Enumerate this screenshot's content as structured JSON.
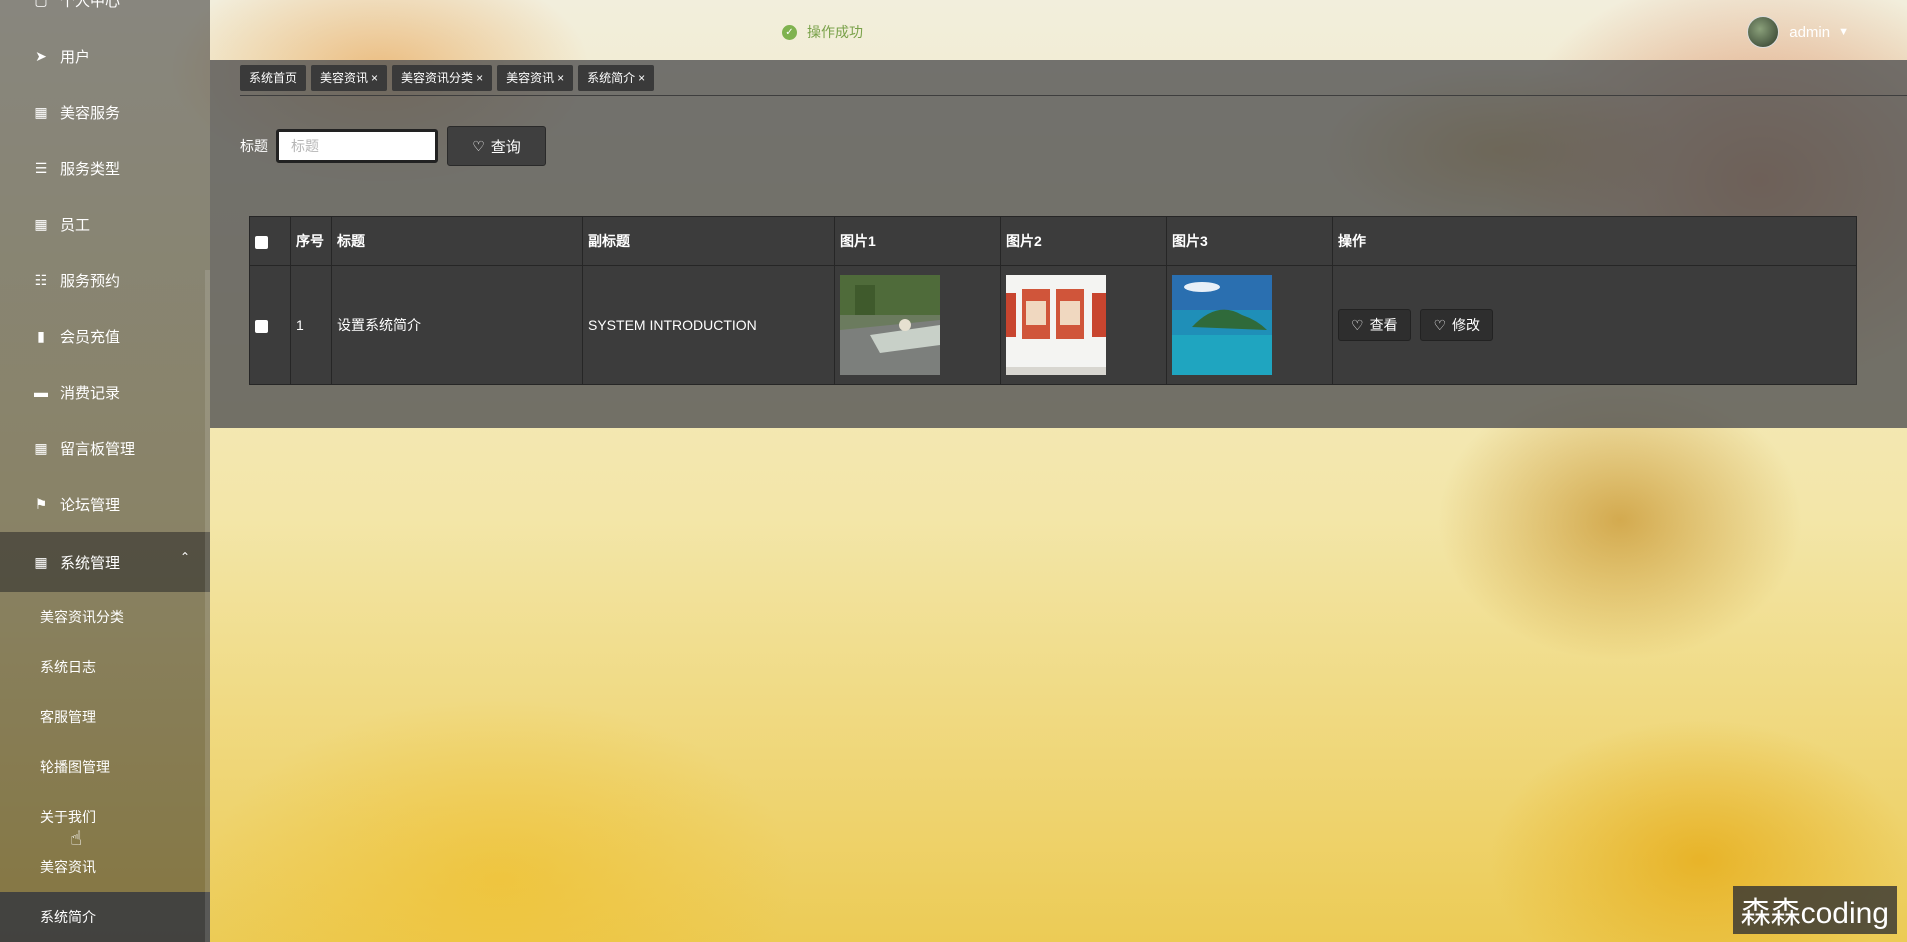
{
  "sidebar": {
    "top_partial": "个人中心",
    "items": [
      {
        "label": "用户",
        "icon": "send-icon",
        "glyph": "➤"
      },
      {
        "label": "美容服务",
        "icon": "grid-icon",
        "glyph": "▦"
      },
      {
        "label": "服务类型",
        "icon": "list-icon",
        "glyph": "☰"
      },
      {
        "label": "员工",
        "icon": "grid-icon",
        "glyph": "▦"
      },
      {
        "label": "服务预约",
        "icon": "sliders-icon",
        "glyph": "☷"
      },
      {
        "label": "会员充值",
        "icon": "book-icon",
        "glyph": "▮"
      },
      {
        "label": "消费记录",
        "icon": "briefcase-icon",
        "glyph": "▬"
      },
      {
        "label": "留言板管理",
        "icon": "grid-icon",
        "glyph": "▦"
      },
      {
        "label": "论坛管理",
        "icon": "flag-icon",
        "glyph": "⚑"
      }
    ],
    "open_group": {
      "label": "系统管理",
      "icon": "apps-icon",
      "glyph": "▦",
      "chevron": "⌃"
    },
    "sub_items": [
      "美容资讯分类",
      "系统日志",
      "客服管理",
      "轮播图管理",
      "关于我们",
      "美容资讯",
      "系统简介"
    ],
    "active_sub": "系统简介"
  },
  "header": {
    "toast": "操作成功",
    "user": "admin"
  },
  "tabs": [
    {
      "label": "系统首页",
      "closable": false
    },
    {
      "label": "美容资讯",
      "closable": true
    },
    {
      "label": "美容资讯分类",
      "closable": true
    },
    {
      "label": "美容资讯",
      "closable": true
    },
    {
      "label": "系统简介",
      "closable": true
    }
  ],
  "search": {
    "label": "标题",
    "placeholder": "标题",
    "button": "查询"
  },
  "table": {
    "headers": [
      "序号",
      "标题",
      "副标题",
      "图片1",
      "图片2",
      "图片3",
      "操作"
    ],
    "rows": [
      {
        "index": "1",
        "title": "设置系统简介",
        "subtitle": "SYSTEM INTRODUCTION"
      }
    ],
    "actions": {
      "view": "查看",
      "edit": "修改"
    }
  },
  "watermark": "森森coding",
  "colors": {
    "sidebar": "#323232",
    "panel": "#555555",
    "table": "#3c3c3c",
    "toast": "#7aa24a"
  }
}
